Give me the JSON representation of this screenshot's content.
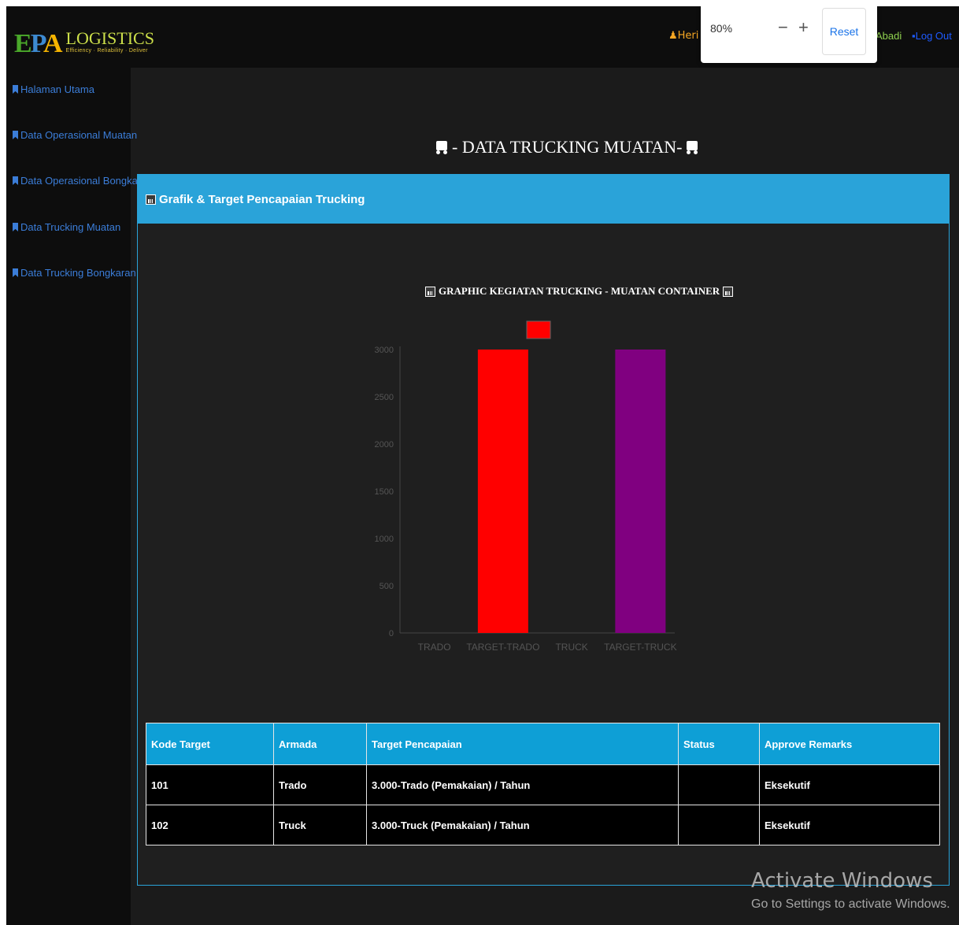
{
  "header": {
    "brand_name": "LOGISTICS",
    "brand_tagline": "Efficiency · Reliability · Deliver",
    "user_name": "Heri El",
    "company_fragment": "Abadi",
    "logout_label": "Log Out"
  },
  "zoom_popup": {
    "value": "80%",
    "minus": "−",
    "plus": "+",
    "reset_label": "Reset"
  },
  "sidebar": {
    "items": [
      {
        "label": "Halaman Utama"
      },
      {
        "label": "Data Operasional Muatan"
      },
      {
        "label": "Data Operasional Bongkaran"
      },
      {
        "label": "Data Trucking Muatan"
      },
      {
        "label": "Data Trucking Bongkaran"
      }
    ]
  },
  "main": {
    "page_title": "- DATA TRUCKING MUATAN-",
    "panel_title": "Grafik & Target Pencapaian Trucking"
  },
  "chart_data": {
    "type": "bar",
    "title": "GRAPHIC KEGIATAN TRUCKING - MUATAN CONTAINER",
    "categories": [
      "TRADO",
      "TARGET-TRADO",
      "TRUCK",
      "TARGET-TRUCK"
    ],
    "values": [
      0,
      3000,
      0,
      3000
    ],
    "colors": [
      "#ff0000",
      "#ff0000",
      "#800080",
      "#800080"
    ],
    "ylim": [
      0,
      3000
    ],
    "yticks": [
      0,
      500,
      1000,
      1500,
      2000,
      2500,
      3000
    ],
    "legend_position": "top",
    "legend_color": "#ff0000"
  },
  "table": {
    "headers": [
      "Kode Target",
      "Armada",
      "Target Pencapaian",
      "Status",
      "Approve Remarks"
    ],
    "rows": [
      [
        "101",
        "Trado",
        "3.000-Trado (Pemakaian) / Tahun",
        "",
        "Eksekutif"
      ],
      [
        "102",
        "Truck",
        "3.000-Truck (Pemakaian) / Tahun",
        "",
        "Eksekutif"
      ]
    ]
  },
  "watermark": {
    "line1": "Activate Windows",
    "line2": "Go to Settings to activate Windows."
  }
}
